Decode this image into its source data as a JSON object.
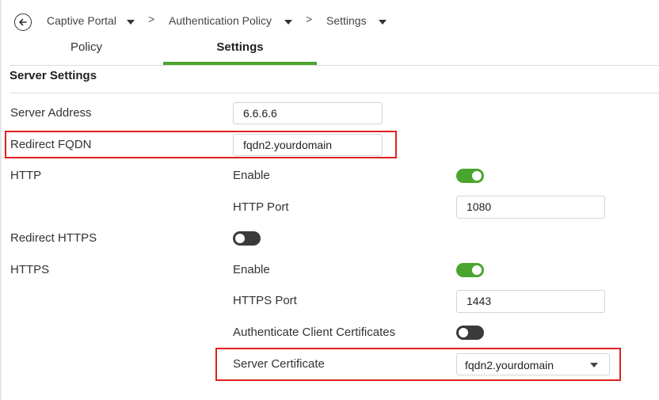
{
  "breadcrumb": {
    "items": [
      {
        "label": "Captive Portal"
      },
      {
        "label": "Authentication Policy"
      },
      {
        "label": "Settings"
      }
    ],
    "separator": ">"
  },
  "tabs": [
    {
      "label": "Policy",
      "active": false
    },
    {
      "label": "Settings",
      "active": true
    }
  ],
  "section": {
    "title": "Server Settings"
  },
  "form": {
    "server_address": {
      "label": "Server Address",
      "value": "6.6.6.6"
    },
    "redirect_fqdn": {
      "label": "Redirect FQDN",
      "value": "fqdn2.yourdomain"
    },
    "http": {
      "label": "HTTP",
      "enable_label": "Enable",
      "enabled": true,
      "port_label": "HTTP Port",
      "port": "1080"
    },
    "redirect_https": {
      "label": "Redirect HTTPS",
      "enabled": false
    },
    "https": {
      "label": "HTTPS",
      "enable_label": "Enable",
      "enabled": true,
      "port_label": "HTTPS Port",
      "port": "1443",
      "auth_client_certs_label": "Authenticate Client Certificates",
      "auth_client_certs_enabled": false,
      "server_certificate_label": "Server Certificate",
      "server_certificate": "fqdn2.yourdomain"
    }
  },
  "colors": {
    "accent": "#4aa52e",
    "highlight": "#e02020",
    "toggle_off": "#3a3a3a"
  }
}
